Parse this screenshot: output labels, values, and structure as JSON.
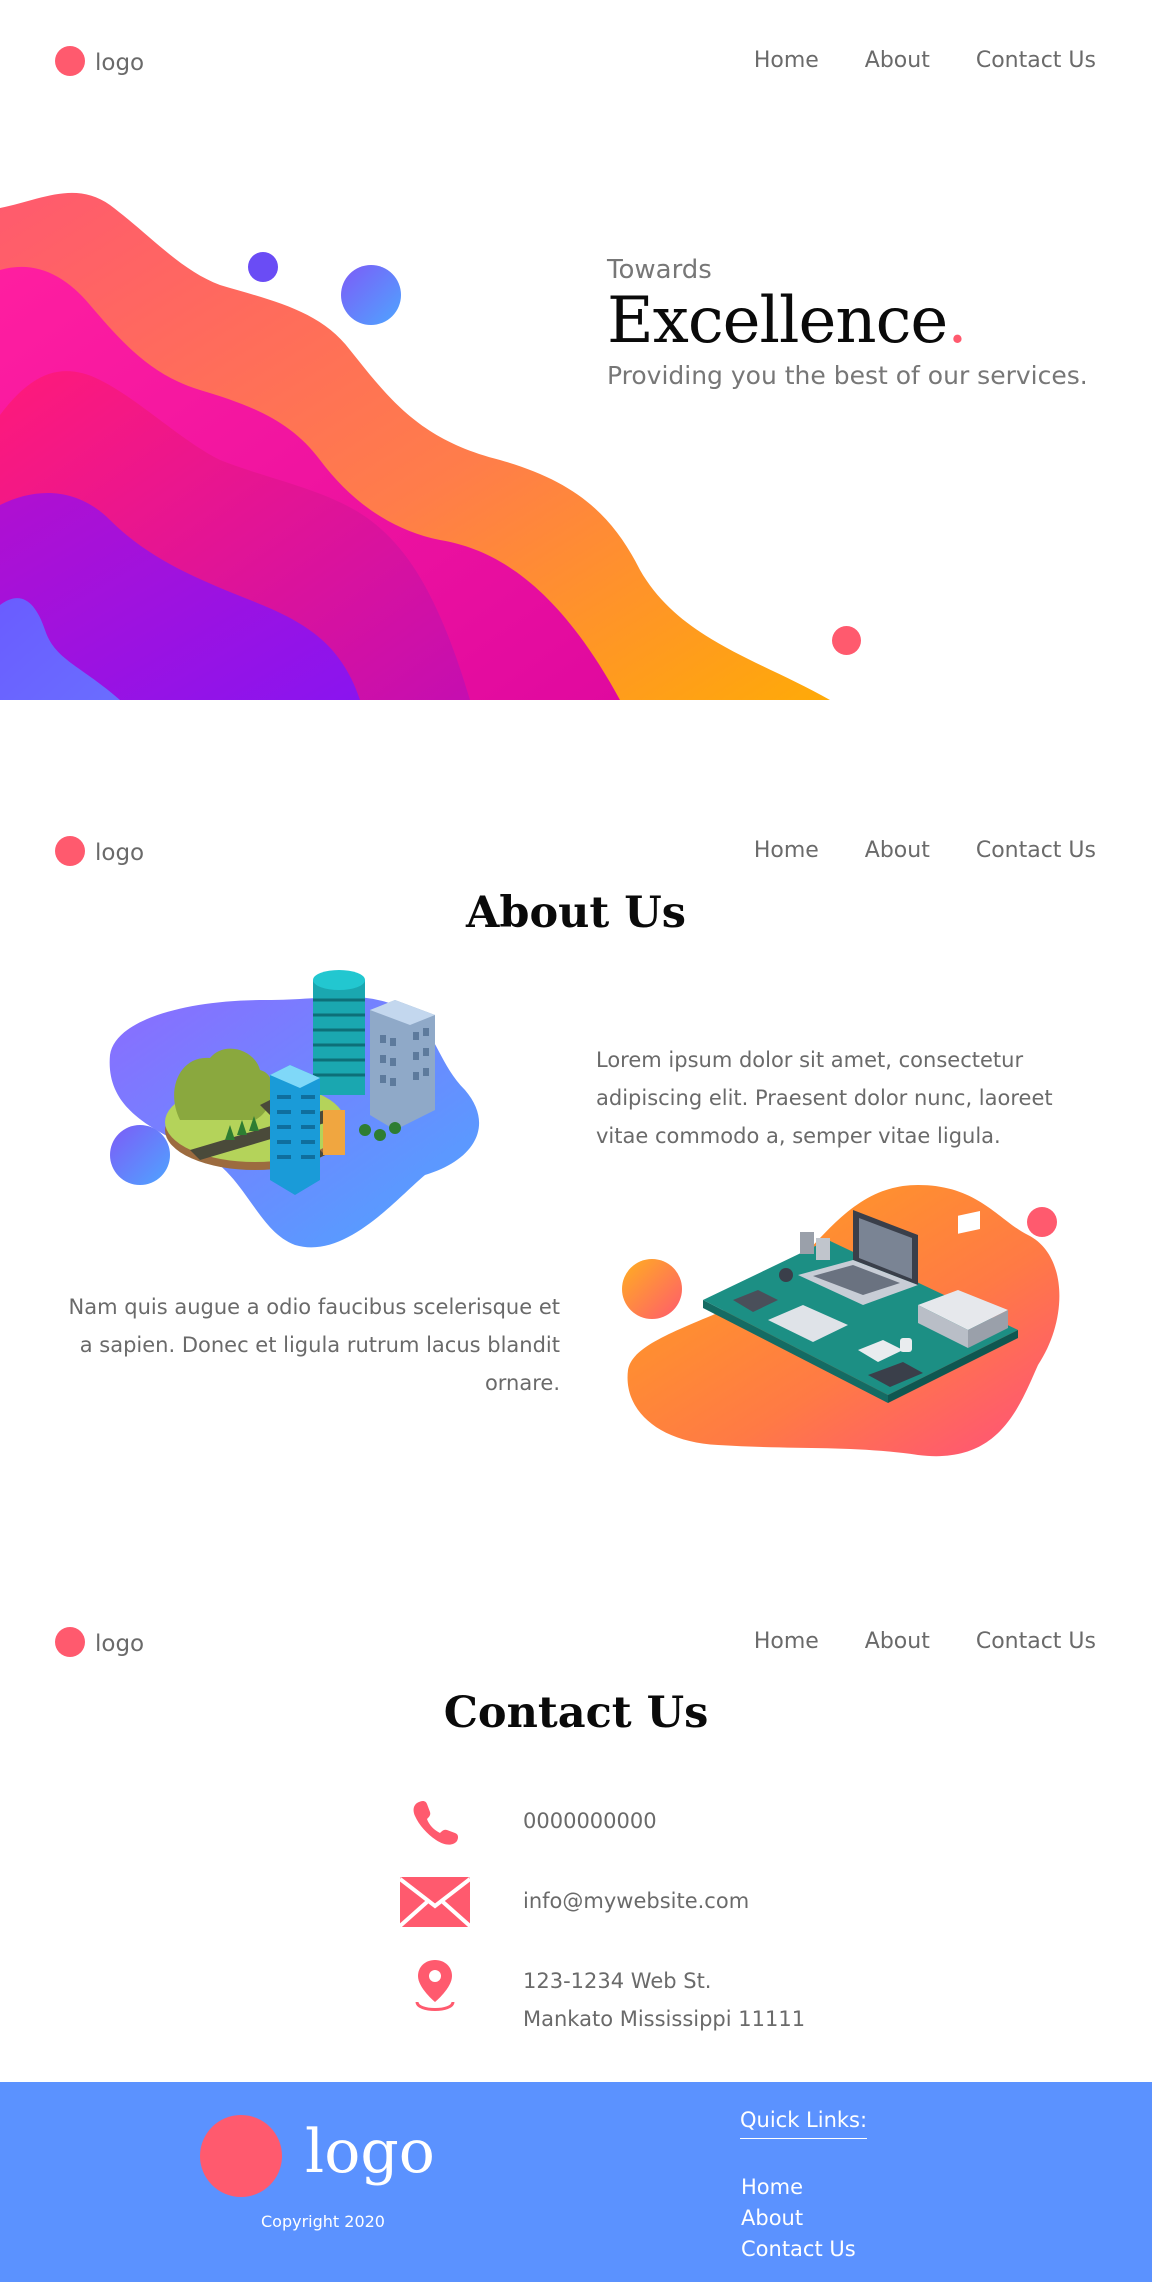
{
  "nav": {
    "logo": "logo",
    "links": [
      "Home",
      "About",
      "Contact Us"
    ]
  },
  "hero": {
    "kicker": "Towards",
    "headline": "Excellence",
    "headline_dot": ".",
    "tagline": "Providing you the best of our services."
  },
  "about": {
    "title": "About Us",
    "paragraph1": "Lorem ipsum dolor sit amet, consectetur adipiscing elit. Praesent dolor nunc, laoreet vitae commodo a, semper vitae ligula.",
    "paragraph2": "Nam quis augue a odio faucibus scelerisque et a sapien. Donec et ligula rutrum lacus blandit ornare."
  },
  "contact": {
    "title": "Contact Us",
    "phone": "0000000000",
    "email": "info@mywebsite.com",
    "address_line1": "123-1234 Web St.",
    "address_line2": "Mankato Mississippi 11111",
    "icons": [
      "phone-icon",
      "mail-icon",
      "location-pin-icon"
    ]
  },
  "footer": {
    "logo": "logo",
    "copyright": "Copyright 2020",
    "quick_links_title": "Quick Links:",
    "quick_links": [
      "Home",
      "About",
      "Contact Us"
    ]
  },
  "colors": {
    "accent": "#ff5a6e",
    "footer_bg": "#5b92ff",
    "text": "#6a6a6a",
    "heading": "#0a0a0a"
  }
}
